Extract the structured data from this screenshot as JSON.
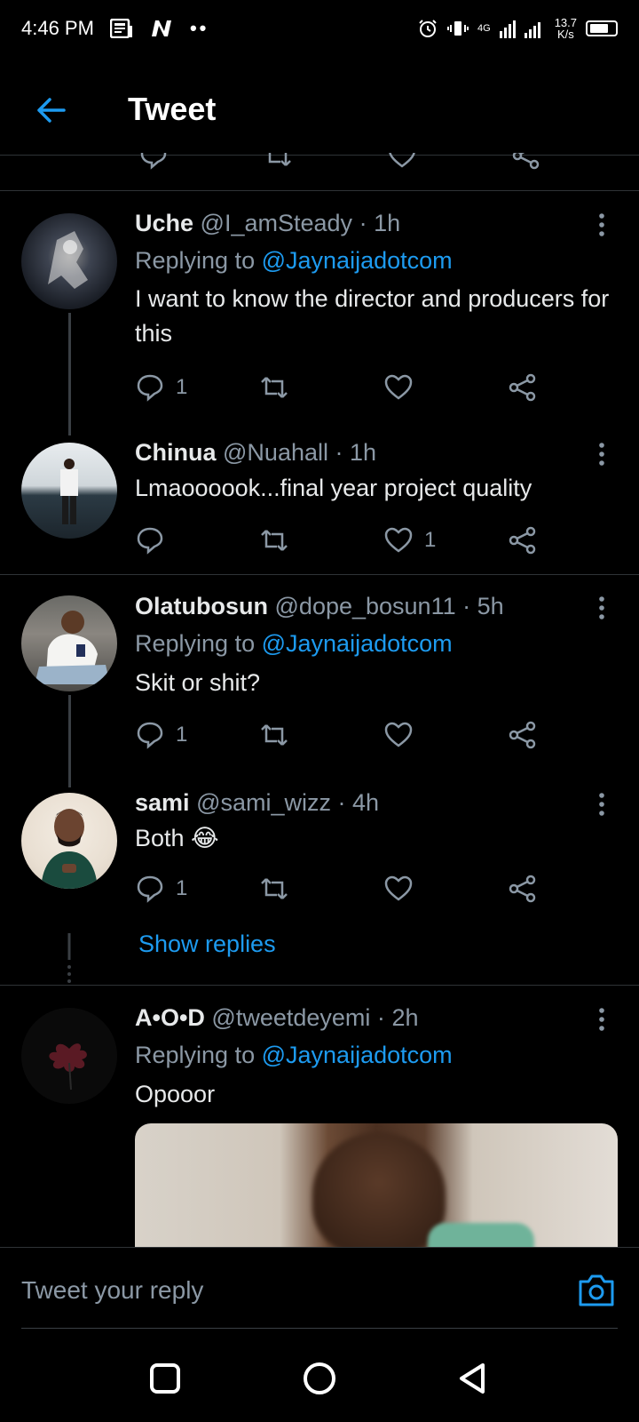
{
  "status_bar": {
    "time": "4:46 PM",
    "network": "4G",
    "speed_value": "13.7",
    "speed_unit": "K/s"
  },
  "header": {
    "title": "Tweet"
  },
  "tweets": [
    {
      "name": "Uche",
      "handle": "@I_amSteady",
      "time": "1h",
      "replying_prefix": "Replying to",
      "replying_to": "@Jaynaijadotcom",
      "text": "I want to know the director and producers for this",
      "reply_count": "1",
      "retweet_count": "",
      "like_count": ""
    },
    {
      "name": "Chinua",
      "handle": "@Nuahall",
      "time": "1h",
      "text": "Lmaoooook...final year project quality",
      "reply_count": "",
      "retweet_count": "",
      "like_count": "1"
    },
    {
      "name": "Olatubosun",
      "handle": "@dope_bosun11",
      "time": "5h",
      "replying_prefix": "Replying to",
      "replying_to": "@Jaynaijadotcom",
      "text": "Skit or shit?",
      "reply_count": "1",
      "retweet_count": "",
      "like_count": ""
    },
    {
      "name": "sami",
      "handle": "@sami_wizz",
      "time": "4h",
      "text": "Both 😂",
      "reply_count": "1",
      "retweet_count": "",
      "like_count": ""
    },
    {
      "name": "A•O•D",
      "handle": "@tweetdeyemi",
      "time": "2h",
      "replying_prefix": "Replying to",
      "replying_to": "@Jaynaijadotcom",
      "text": "Opooor"
    }
  ],
  "show_replies": "Show replies",
  "reply_bar": {
    "placeholder": "Tweet your reply"
  },
  "icons": {
    "accent": "#1d9bf0",
    "muted": "#8b98a5"
  }
}
